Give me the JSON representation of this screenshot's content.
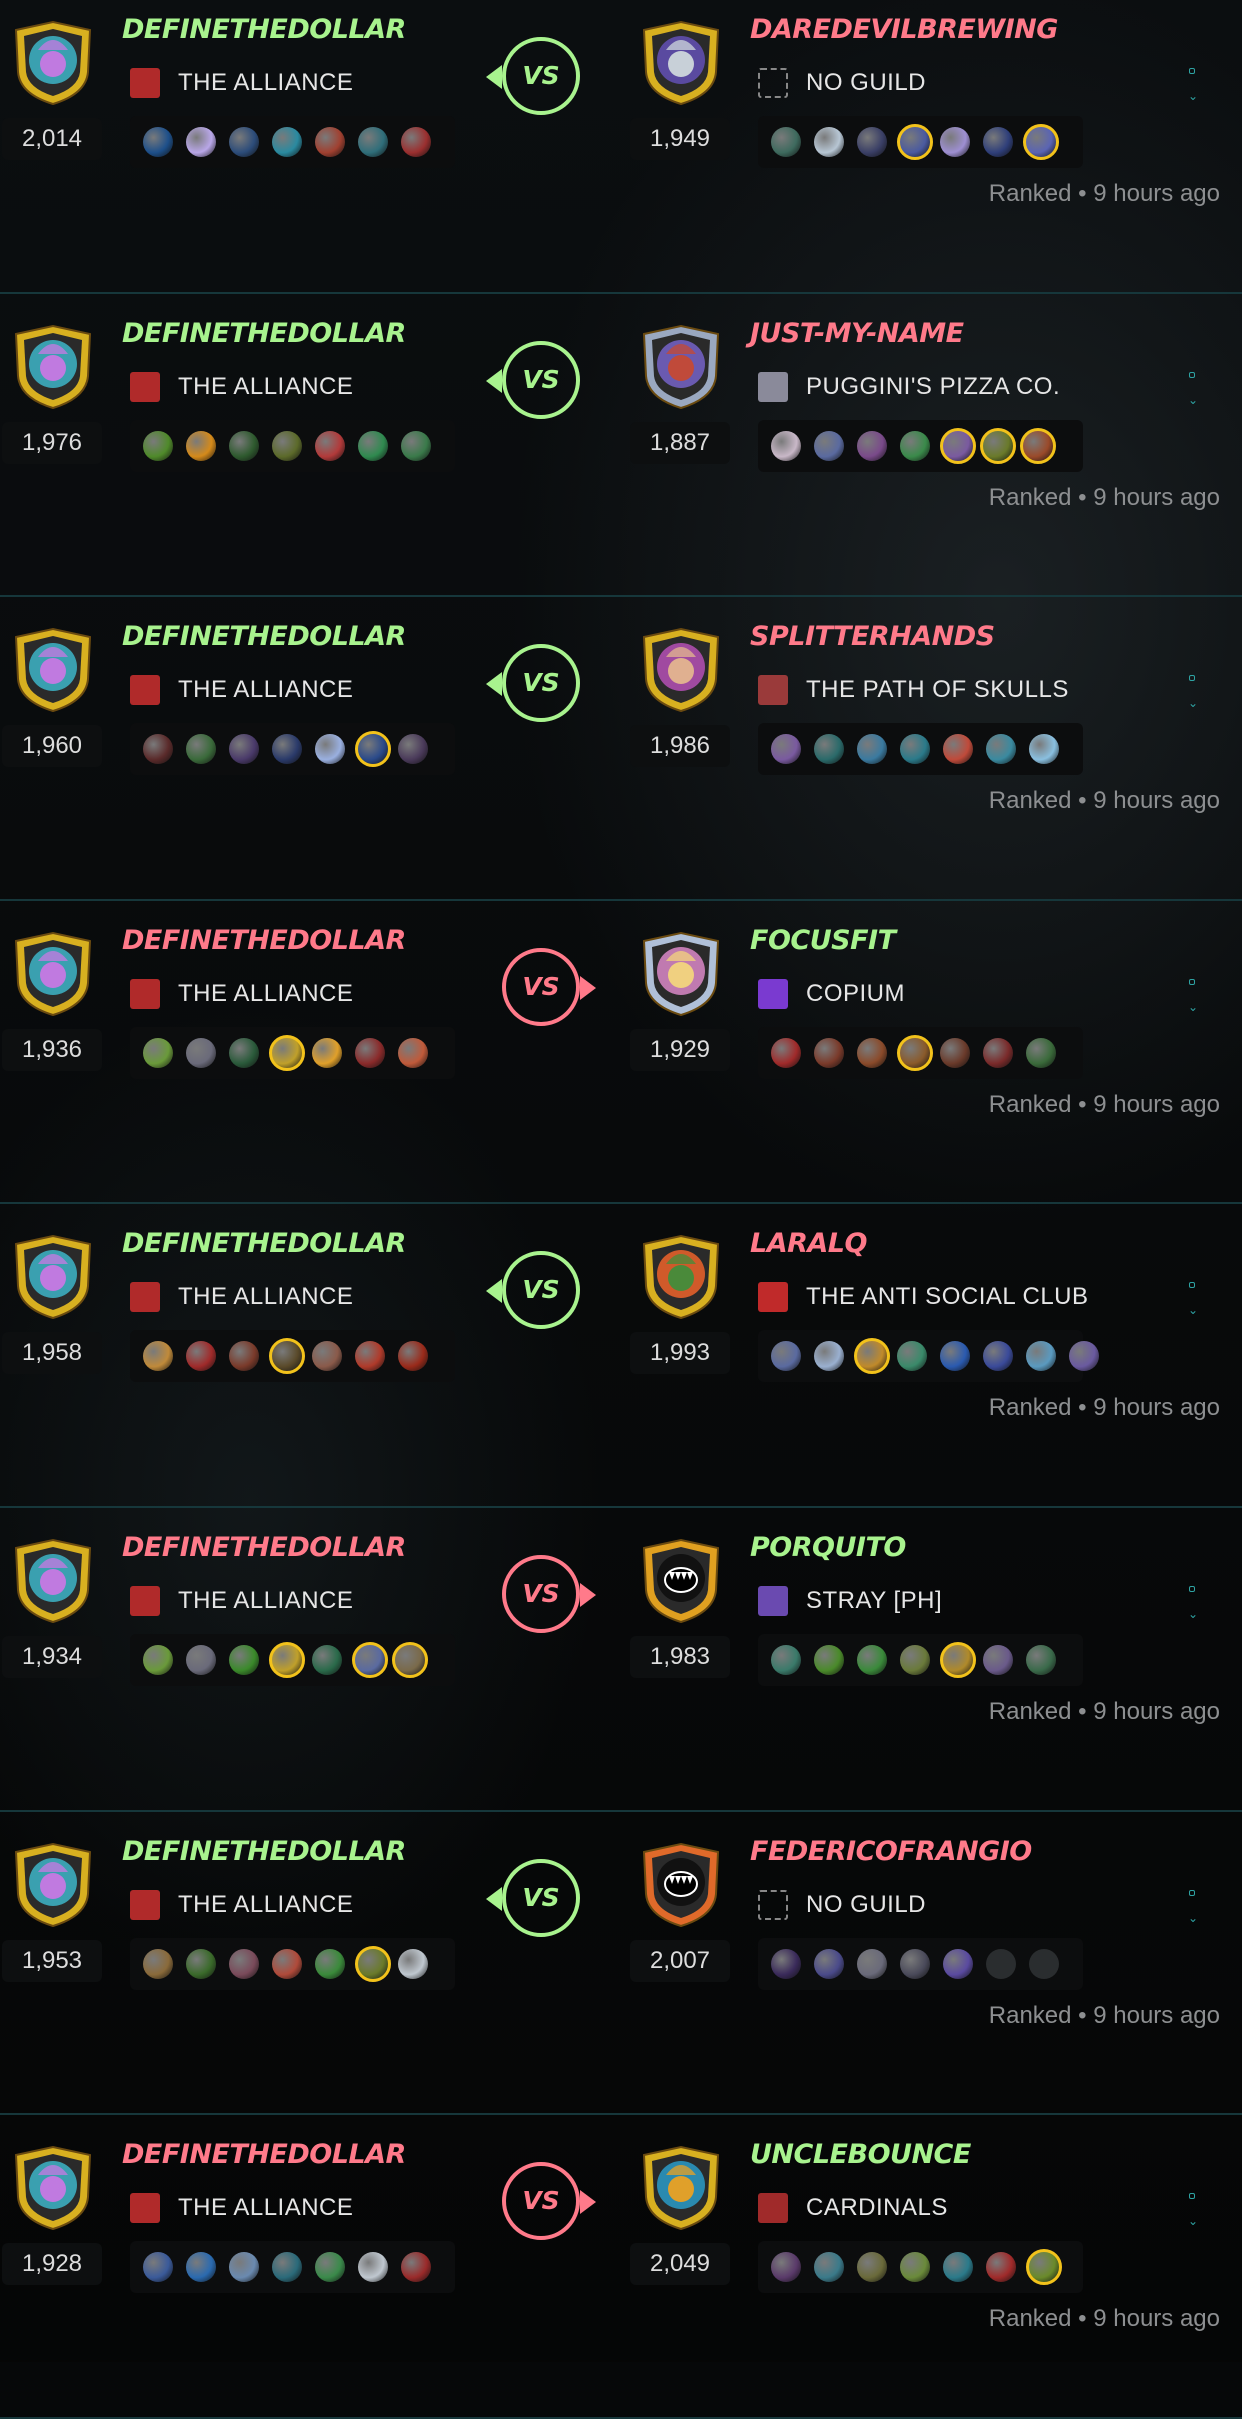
{
  "battles": [
    {
      "winner": "left",
      "left": {
        "name": "DEFINETHEDOLLAR",
        "rating": "2,014",
        "guild": "THE ALLIANCE",
        "guild_icon": "alliance-banner-icon",
        "avatar": "wizard",
        "cards": [
          {
            "c": "#1d4f8a"
          },
          {
            "c": "#b9a7e8"
          },
          {
            "c": "#2c4c7a"
          },
          {
            "c": "#2a8aa0"
          },
          {
            "c": "#a04030"
          },
          {
            "c": "#2f6e7a"
          },
          {
            "c": "#9b2f2f"
          }
        ]
      },
      "right": {
        "name": "DAREDEVILBREWING",
        "rating": "1,949",
        "guild": "NO GUILD",
        "guild_icon": "no-guild-icon",
        "avatar": "skeleton",
        "cards": [
          {
            "c": "#3e6a5e"
          },
          {
            "c": "#b7c6d4"
          },
          {
            "c": "#3a3f66"
          },
          {
            "c": "#4a5aa0",
            "legend": true
          },
          {
            "c": "#9e8fd2"
          },
          {
            "c": "#2f3f7a"
          },
          {
            "c": "#5a64b4",
            "legend": true
          }
        ]
      },
      "meta": "Ranked • 9 hours ago"
    },
    {
      "winner": "left",
      "left": {
        "name": "DEFINETHEDOLLAR",
        "rating": "1,976",
        "guild": "THE ALLIANCE",
        "guild_icon": "alliance-banner-icon",
        "avatar": "wizard",
        "cards": [
          {
            "c": "#4f8a2a"
          },
          {
            "c": "#d58a1a"
          },
          {
            "c": "#2e5a2e"
          },
          {
            "c": "#5c6a2a"
          },
          {
            "c": "#b23a3a"
          },
          {
            "c": "#2f8a4f"
          },
          {
            "c": "#3a7a4a"
          }
        ]
      },
      "right": {
        "name": "JUST-MY-NAME",
        "rating": "1,887",
        "guild": "PUGGINI'S PIZZA CO.",
        "guild_icon": "pizza-guild-icon",
        "avatar": "apple",
        "cards": [
          {
            "c": "#c9b8c8"
          },
          {
            "c": "#5a6aa0"
          },
          {
            "c": "#7a4a8a"
          },
          {
            "c": "#3a8a4a"
          },
          {
            "c": "#7a5aa0",
            "legend": true
          },
          {
            "c": "#6a7a2a",
            "legend": true
          },
          {
            "c": "#9a4a2a",
            "legend": true
          }
        ]
      },
      "meta": "Ranked • 9 hours ago"
    },
    {
      "winner": "left",
      "left": {
        "name": "DEFINETHEDOLLAR",
        "rating": "1,960",
        "guild": "THE ALLIANCE",
        "guild_icon": "alliance-banner-icon",
        "avatar": "wizard",
        "cards": [
          {
            "c": "#5a2a2a"
          },
          {
            "c": "#3a6a3a"
          },
          {
            "c": "#4a3a6a"
          },
          {
            "c": "#2a3a6a"
          },
          {
            "c": "#9ab0e0"
          },
          {
            "c": "#2a4a8a",
            "legend": true
          },
          {
            "c": "#4a3a5a"
          }
        ]
      },
      "right": {
        "name": "SPLITTERHANDS",
        "rating": "1,986",
        "guild": "THE PATH OF SKULLS",
        "guild_icon": "skull-guild-icon",
        "avatar": "girl",
        "cards": [
          {
            "c": "#7a5aa0"
          },
          {
            "c": "#2a6a6a"
          },
          {
            "c": "#3a7aa0"
          },
          {
            "c": "#2a7a8a"
          },
          {
            "c": "#c04a3a"
          },
          {
            "c": "#3a8aa0"
          },
          {
            "c": "#8ac0e0"
          }
        ]
      },
      "meta": "Ranked • 9 hours ago"
    },
    {
      "winner": "right",
      "left": {
        "name": "DEFINETHEDOLLAR",
        "rating": "1,936",
        "guild": "THE ALLIANCE",
        "guild_icon": "alliance-banner-icon",
        "avatar": "wizard",
        "cards": [
          {
            "c": "#6a9a3a"
          },
          {
            "c": "#6a6a7a"
          },
          {
            "c": "#2a5a3a"
          },
          {
            "c": "#c0a02a",
            "legend": true
          },
          {
            "c": "#e0a02a"
          },
          {
            "c": "#8a2a2a"
          },
          {
            "c": "#c05a3a"
          }
        ]
      },
      "right": {
        "name": "FOCUSFIT",
        "rating": "1,929",
        "guild": "COPIUM",
        "guild_icon": "copium-guild-icon",
        "avatar": "blonde",
        "cards": [
          {
            "c": "#a02a2a"
          },
          {
            "c": "#7a3a2a"
          },
          {
            "c": "#8a4a2a"
          },
          {
            "c": "#8a5a2a",
            "legend": true
          },
          {
            "c": "#6a3a2a"
          },
          {
            "c": "#7a2a2a"
          },
          {
            "c": "#3a6a3a"
          }
        ]
      },
      "meta": "Ranked • 9 hours ago"
    },
    {
      "winner": "left",
      "left": {
        "name": "DEFINETHEDOLLAR",
        "rating": "1,958",
        "guild": "THE ALLIANCE",
        "guild_icon": "alliance-banner-icon",
        "avatar": "wizard",
        "cards": [
          {
            "c": "#c08a3a"
          },
          {
            "c": "#a02a2a"
          },
          {
            "c": "#7a3a2a"
          },
          {
            "c": "#5a4a2a",
            "legend": true
          },
          {
            "c": "#8a5a4a"
          },
          {
            "c": "#b03a2a"
          },
          {
            "c": "#9a2a1a"
          }
        ]
      },
      "right": {
        "name": "LARALQ",
        "rating": "1,993",
        "guild": "THE ANTI SOCIAL CLUB",
        "guild_icon": "anti-social-guild-icon",
        "avatar": "orc",
        "cards": [
          {
            "c": "#5a6aa0"
          },
          {
            "c": "#9ab0d0"
          },
          {
            "c": "#c08a2a",
            "legend": true
          },
          {
            "c": "#3a8a6a"
          },
          {
            "c": "#2a5ab0"
          },
          {
            "c": "#3a4a9a"
          },
          {
            "c": "#5a9ac0"
          },
          {
            "c": "#6a5aa0"
          }
        ]
      },
      "meta": "Ranked • 9 hours ago"
    },
    {
      "winner": "right",
      "left": {
        "name": "DEFINETHEDOLLAR",
        "rating": "1,934",
        "guild": "THE ALLIANCE",
        "guild_icon": "alliance-banner-icon",
        "avatar": "wizard",
        "cards": [
          {
            "c": "#6a9a3a"
          },
          {
            "c": "#6a6a7a"
          },
          {
            "c": "#3a8a2a"
          },
          {
            "c": "#c0a02a",
            "legend": true
          },
          {
            "c": "#2a6a4a"
          },
          {
            "c": "#5a6aa0",
            "legend": true
          },
          {
            "c": "#7a6a4a",
            "legend": true
          }
        ]
      },
      "right": {
        "name": "PORQUITO",
        "rating": "1,983",
        "guild": "STRAY [PH]",
        "guild_icon": "stray-guild-icon",
        "avatar": "monster",
        "cards": [
          {
            "c": "#3a7a6a"
          },
          {
            "c": "#4a8a2a"
          },
          {
            "c": "#3a8a3a"
          },
          {
            "c": "#6a7a3a"
          },
          {
            "c": "#b08a2a",
            "legend": true
          },
          {
            "c": "#6a5a8a"
          },
          {
            "c": "#3a6a4a"
          }
        ]
      },
      "meta": "Ranked • 9 hours ago"
    },
    {
      "winner": "left",
      "left": {
        "name": "DEFINETHEDOLLAR",
        "rating": "1,953",
        "guild": "THE ALLIANCE",
        "guild_icon": "alliance-banner-icon",
        "avatar": "wizard",
        "cards": [
          {
            "c": "#8a6a3a"
          },
          {
            "c": "#3a6a2a"
          },
          {
            "c": "#7a4a5a"
          },
          {
            "c": "#b04a3a"
          },
          {
            "c": "#3a8a3a"
          },
          {
            "c": "#6a7a2a",
            "legend": true
          },
          {
            "c": "#c0c8d0"
          }
        ]
      },
      "right": {
        "name": "FEDERICOFRANGIO",
        "rating": "2,007",
        "guild": "NO GUILD",
        "guild_icon": "no-guild-icon",
        "avatar": "monster-orange",
        "cards": [
          {
            "c": "#3a2a5a"
          },
          {
            "c": "#4a4a8a"
          },
          {
            "c": "#6a6a7a"
          },
          {
            "c": "#4a4a5a"
          },
          {
            "c": "#5a4aa0"
          },
          {
            "c": "#2a2d2f",
            "empty": true
          },
          {
            "c": "#2a2d2f",
            "empty": true
          }
        ]
      },
      "meta": "Ranked • 9 hours ago"
    },
    {
      "winner": "right",
      "left": {
        "name": "DEFINETHEDOLLAR",
        "rating": "1,928",
        "guild": "THE ALLIANCE",
        "guild_icon": "alliance-banner-icon",
        "avatar": "wizard",
        "cards": [
          {
            "c": "#3a5a9a"
          },
          {
            "c": "#2a6ab0"
          },
          {
            "c": "#6a8ab0"
          },
          {
            "c": "#2a6a7a"
          },
          {
            "c": "#3a8a4a"
          },
          {
            "c": "#c0c8d0"
          },
          {
            "c": "#9a2a2a"
          }
        ]
      },
      "right": {
        "name": "UNCLEBOUNCE",
        "rating": "2,049",
        "guild": "CARDINALS",
        "guild_icon": "cardinals-guild-icon",
        "avatar": "bird",
        "cards": [
          {
            "c": "#5a3a6a"
          },
          {
            "c": "#3a7a8a"
          },
          {
            "c": "#6a6a3a"
          },
          {
            "c": "#6a8a3a"
          },
          {
            "c": "#2a7a8a"
          },
          {
            "c": "#a02a2a"
          },
          {
            "c": "#6a8a2a",
            "legend": true
          }
        ]
      },
      "meta": "Ranked • 9 hours ago"
    }
  ],
  "labels": {
    "vs": "VS"
  },
  "colors": {
    "win": "#a8f38e",
    "loss": "#ff7a8a",
    "divider": "#16373b",
    "menu_accent": "#2ea3a3"
  }
}
